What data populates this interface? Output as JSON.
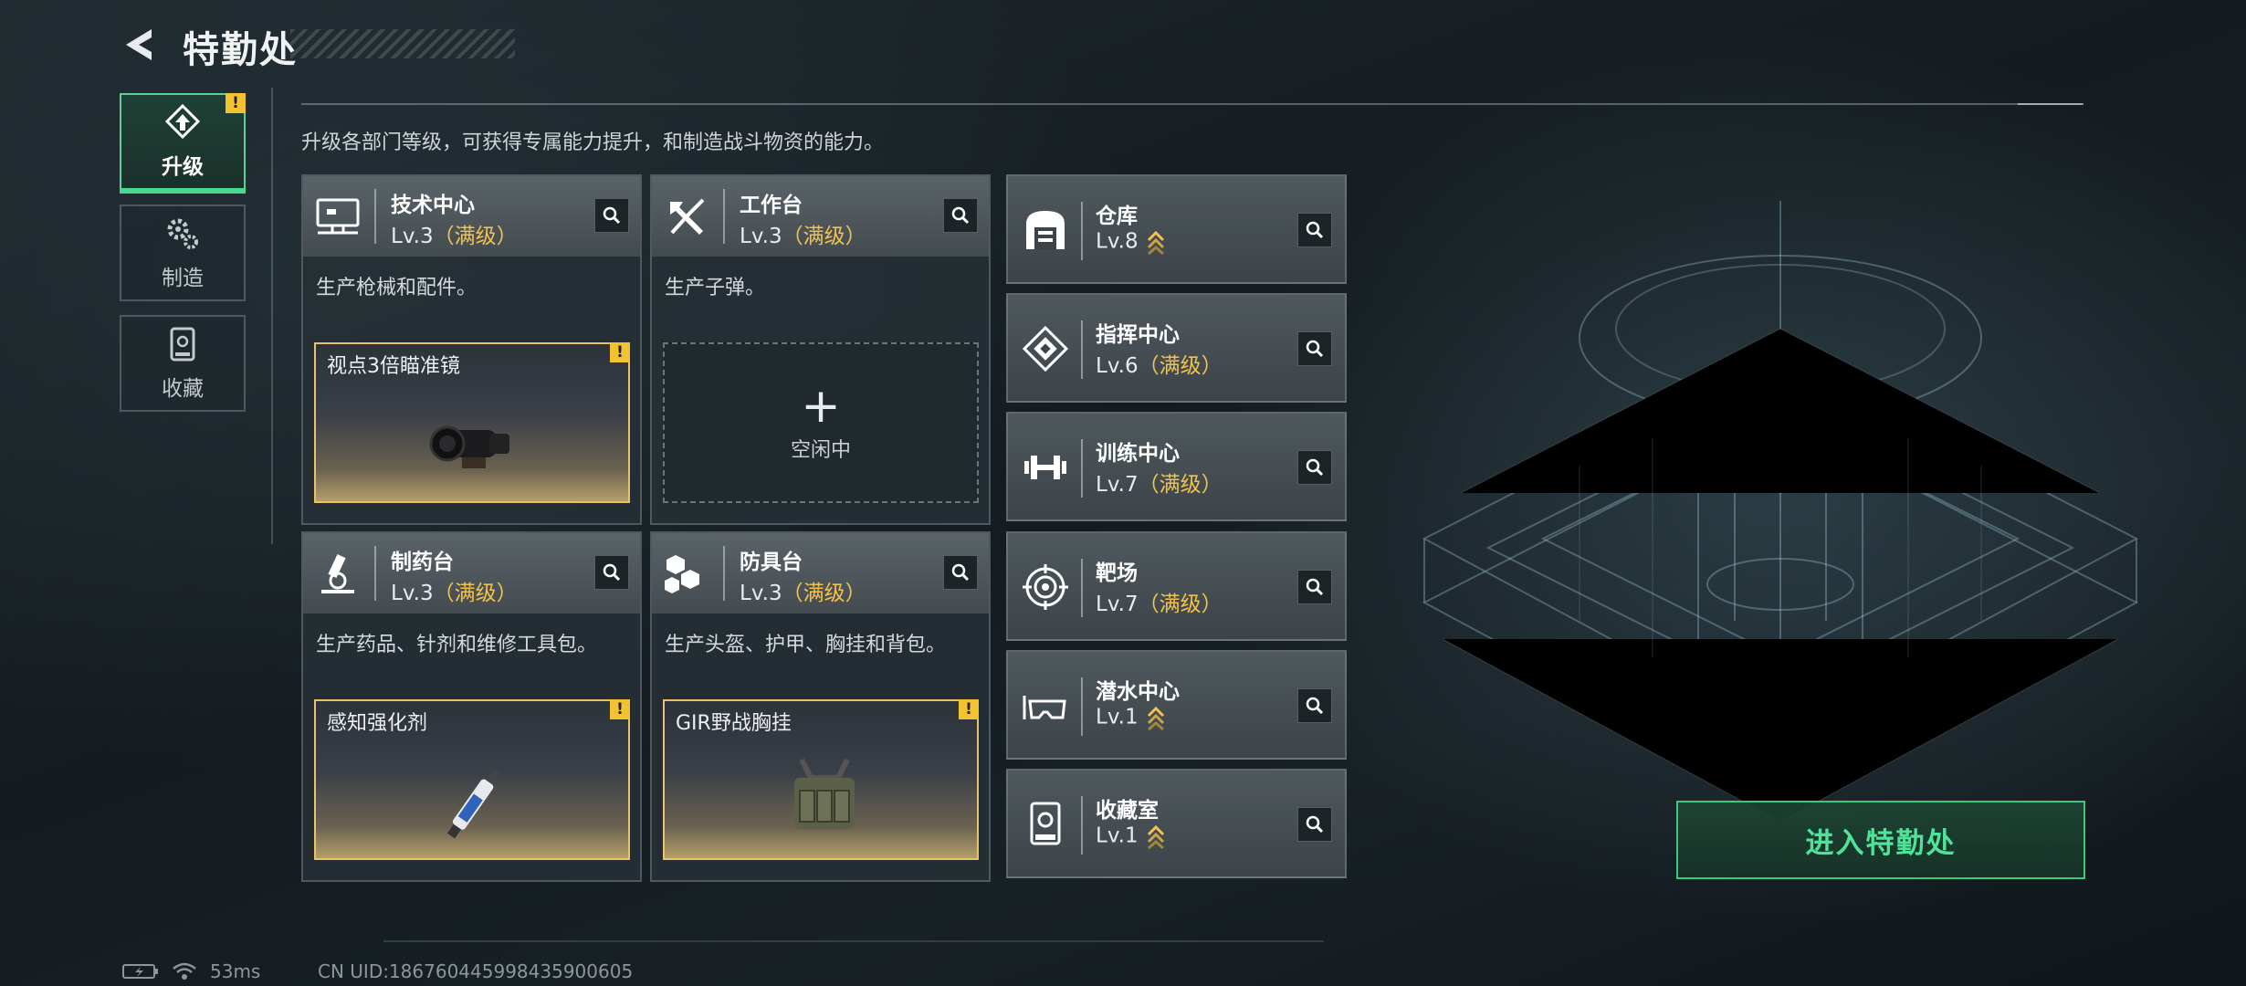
{
  "header": {
    "title": "特勤处"
  },
  "nav": {
    "tabs": [
      {
        "label": "升级",
        "icon": "upgrade-icon",
        "active": true,
        "alert": "!"
      },
      {
        "label": "制造",
        "icon": "gears-icon",
        "active": false
      },
      {
        "label": "收藏",
        "icon": "display-case-icon",
        "active": false
      }
    ]
  },
  "description": "升级各部门等级，可获得专属能力提升，和制造战斗物资的能力。",
  "departments": [
    {
      "name": "技术中心",
      "level": "Lv.3",
      "max_tag": "（满级）",
      "desc": "生产枪械和配件。",
      "slot": {
        "item": "视点3倍瞄准镜",
        "alert": "!"
      }
    },
    {
      "name": "工作台",
      "level": "Lv.3",
      "max_tag": "（满级）",
      "desc": "生产子弹。",
      "slot": {
        "idle_label": "空闲中",
        "plus": "+"
      }
    },
    {
      "name": "制药台",
      "level": "Lv.3",
      "max_tag": "（满级）",
      "desc": "生产药品、针剂和维修工具包。",
      "slot": {
        "item": "感知强化剂",
        "alert": "!"
      }
    },
    {
      "name": "防具台",
      "level": "Lv.3",
      "max_tag": "（满级）",
      "desc": "生产头盔、护甲、胸挂和背包。",
      "slot": {
        "item": "GIR野战胸挂",
        "alert": "!"
      }
    }
  ],
  "side_departments": [
    {
      "name": "仓库",
      "level": "Lv.8",
      "max_tag": "",
      "upgradable": true
    },
    {
      "name": "指挥中心",
      "level": "Lv.6",
      "max_tag": "（满级）",
      "upgradable": false
    },
    {
      "name": "训练中心",
      "level": "Lv.7",
      "max_tag": "（满级）",
      "upgradable": false
    },
    {
      "name": "靶场",
      "level": "Lv.7",
      "max_tag": "（满级）",
      "upgradable": false
    },
    {
      "name": "潜水中心",
      "level": "Lv.1",
      "max_tag": "",
      "upgradable": true
    },
    {
      "name": "收藏室",
      "level": "Lv.1",
      "max_tag": "",
      "upgradable": true
    }
  ],
  "enter_button": "进入特勤处",
  "status": {
    "ping": "53ms",
    "uid": "CN UID:1867604459984359006​05"
  },
  "colors": {
    "accent_green": "#47d98e",
    "max_level": "#f3c14d",
    "alert": "#f2c232"
  }
}
